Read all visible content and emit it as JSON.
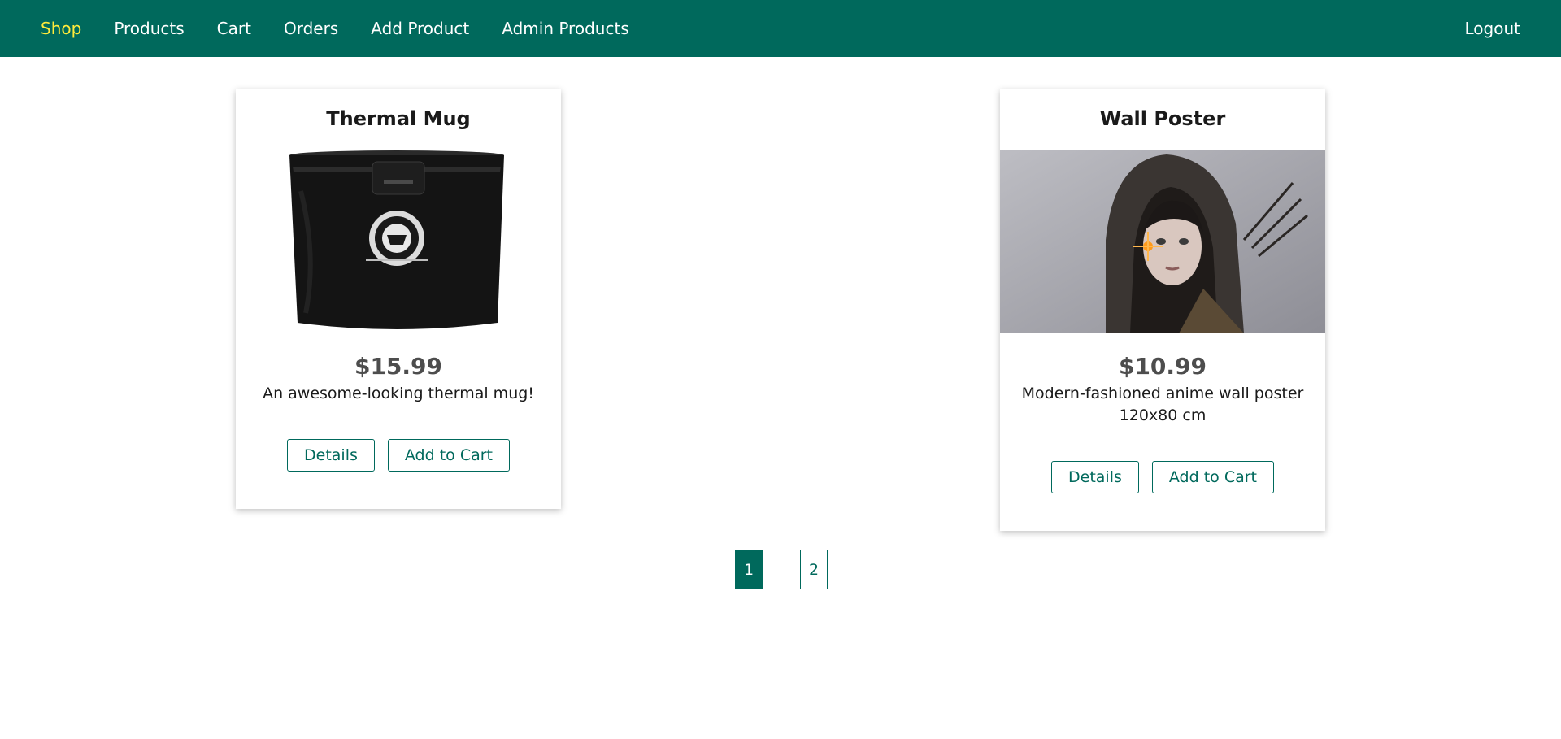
{
  "nav": {
    "items": [
      {
        "label": "Shop",
        "active": true
      },
      {
        "label": "Products"
      },
      {
        "label": "Cart"
      },
      {
        "label": "Orders"
      },
      {
        "label": "Add Product"
      },
      {
        "label": "Admin Products"
      }
    ],
    "logout": "Logout"
  },
  "products": [
    {
      "title": "Thermal Mug",
      "price": "$15.99",
      "description": "An awesome-looking thermal mug!",
      "details_label": "Details",
      "cart_label": "Add to Cart"
    },
    {
      "title": "Wall Poster",
      "price": "$10.99",
      "description": "Modern-fashioned anime wall poster 120x80 cm",
      "details_label": "Details",
      "cart_label": "Add to Cart"
    }
  ],
  "pagination": {
    "pages": [
      "1",
      "2"
    ],
    "current": "1"
  },
  "colors": {
    "primary": "#00695c",
    "active_nav": "#ffeb3b"
  }
}
